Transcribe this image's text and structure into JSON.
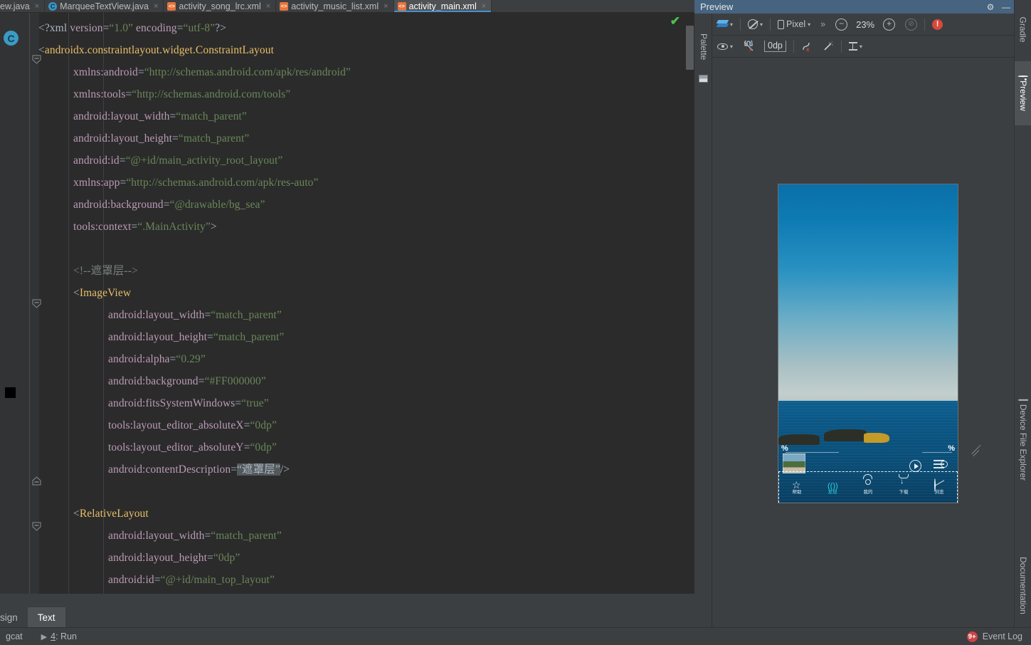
{
  "editor": {
    "tabs": [
      {
        "label": "ew.java",
        "icon": "java-class-icon",
        "type": "java",
        "active": false,
        "clipped": true
      },
      {
        "label": "MarqueeTextView.java",
        "icon": "java-class-icon",
        "type": "java",
        "active": false,
        "clipped": false
      },
      {
        "label": "activity_song_lrc.xml",
        "icon": "xml-layout-icon",
        "type": "xml",
        "active": false,
        "clipped": false
      },
      {
        "label": "activity_music_list.xml",
        "icon": "xml-layout-icon",
        "type": "xml",
        "active": false,
        "clipped": false
      },
      {
        "label": "activity_main.xml",
        "icon": "xml-layout-icon",
        "type": "xml",
        "active": true,
        "clipped": false
      }
    ],
    "tab_close_glyph": "×",
    "gutter": {
      "class_marker": "C",
      "color_swatch": "#000000"
    },
    "inspection_status_icon": "green-check-icon",
    "code_lines": [
      {
        "indent": 0,
        "tokens": [
          {
            "t": "punc",
            "v": "<?xml "
          },
          {
            "t": "attr",
            "v": "version"
          },
          {
            "t": "punc",
            "v": "="
          },
          {
            "t": "str",
            "v": "“1.0”"
          },
          {
            "t": "punc",
            "v": " "
          },
          {
            "t": "attr",
            "v": "encoding"
          },
          {
            "t": "punc",
            "v": "="
          },
          {
            "t": "str",
            "v": "“utf-8”"
          },
          {
            "t": "punc",
            "v": "?>"
          }
        ]
      },
      {
        "indent": 0,
        "tokens": [
          {
            "t": "punc",
            "v": "<"
          },
          {
            "t": "tagname",
            "v": "androidx.constraintlayout.widget.ConstraintLayout"
          }
        ]
      },
      {
        "indent": 1,
        "tokens": [
          {
            "t": "attr",
            "v": "xmlns:android"
          },
          {
            "t": "punc",
            "v": "="
          },
          {
            "t": "str",
            "v": "“http://schemas.android.com/apk/res/android”"
          }
        ]
      },
      {
        "indent": 1,
        "tokens": [
          {
            "t": "attr",
            "v": "xmlns:tools"
          },
          {
            "t": "punc",
            "v": "="
          },
          {
            "t": "str",
            "v": "“http://schemas.android.com/tools”"
          }
        ]
      },
      {
        "indent": 1,
        "tokens": [
          {
            "t": "attr",
            "v": "android:layout_width"
          },
          {
            "t": "punc",
            "v": "="
          },
          {
            "t": "str",
            "v": "“match_parent”"
          }
        ]
      },
      {
        "indent": 1,
        "tokens": [
          {
            "t": "attr",
            "v": "android:layout_height"
          },
          {
            "t": "punc",
            "v": "="
          },
          {
            "t": "str",
            "v": "“match_parent”"
          }
        ]
      },
      {
        "indent": 1,
        "tokens": [
          {
            "t": "attr",
            "v": "android:id"
          },
          {
            "t": "punc",
            "v": "="
          },
          {
            "t": "str",
            "v": "“@+id/main_activity_root_layout”"
          }
        ]
      },
      {
        "indent": 1,
        "tokens": [
          {
            "t": "attr",
            "v": "xmlns:app"
          },
          {
            "t": "punc",
            "v": "="
          },
          {
            "t": "str",
            "v": "“http://schemas.android.com/apk/res-auto”"
          }
        ]
      },
      {
        "indent": 1,
        "tokens": [
          {
            "t": "attr",
            "v": "android:background"
          },
          {
            "t": "punc",
            "v": "="
          },
          {
            "t": "str",
            "v": "“@drawable/bg_sea”"
          }
        ]
      },
      {
        "indent": 1,
        "tokens": [
          {
            "t": "attr",
            "v": "tools:context"
          },
          {
            "t": "punc",
            "v": "="
          },
          {
            "t": "str",
            "v": "“.MainActivity”"
          },
          {
            "t": "punc",
            "v": ">"
          }
        ]
      },
      {
        "indent": 0,
        "tokens": []
      },
      {
        "indent": 1,
        "tokens": [
          {
            "t": "cmt",
            "v": "<!--遮罩层-->"
          }
        ]
      },
      {
        "indent": 1,
        "tokens": [
          {
            "t": "punc",
            "v": "<"
          },
          {
            "t": "tagname",
            "v": "ImageView"
          }
        ]
      },
      {
        "indent": 2,
        "tokens": [
          {
            "t": "attr",
            "v": "android:layout_width"
          },
          {
            "t": "punc",
            "v": "="
          },
          {
            "t": "str",
            "v": "“match_parent”"
          }
        ]
      },
      {
        "indent": 2,
        "tokens": [
          {
            "t": "attr",
            "v": "android:layout_height"
          },
          {
            "t": "punc",
            "v": "="
          },
          {
            "t": "str",
            "v": "“match_parent”"
          }
        ]
      },
      {
        "indent": 2,
        "tokens": [
          {
            "t": "attr",
            "v": "android:alpha"
          },
          {
            "t": "punc",
            "v": "="
          },
          {
            "t": "str",
            "v": "“0.29”"
          }
        ]
      },
      {
        "indent": 2,
        "tokens": [
          {
            "t": "attr",
            "v": "android:background"
          },
          {
            "t": "punc",
            "v": "="
          },
          {
            "t": "str",
            "v": "“#FF000000”"
          }
        ]
      },
      {
        "indent": 2,
        "tokens": [
          {
            "t": "attr",
            "v": "android:fitsSystemWindows"
          },
          {
            "t": "punc",
            "v": "="
          },
          {
            "t": "str",
            "v": "“true”"
          }
        ]
      },
      {
        "indent": 2,
        "tokens": [
          {
            "t": "attr",
            "v": "tools:layout_editor_absoluteX"
          },
          {
            "t": "punc",
            "v": "="
          },
          {
            "t": "str",
            "v": "“0dp”"
          }
        ]
      },
      {
        "indent": 2,
        "tokens": [
          {
            "t": "attr",
            "v": "tools:layout_editor_absoluteY"
          },
          {
            "t": "punc",
            "v": "="
          },
          {
            "t": "str",
            "v": "“0dp”"
          }
        ]
      },
      {
        "indent": 2,
        "tokens": [
          {
            "t": "attr",
            "v": "android:contentDescription"
          },
          {
            "t": "punc",
            "v": "="
          },
          {
            "t": "hl",
            "v": "“遮罩层”"
          },
          {
            "t": "punc",
            "v": "/>"
          }
        ]
      },
      {
        "indent": 0,
        "tokens": []
      },
      {
        "indent": 1,
        "tokens": [
          {
            "t": "punc",
            "v": "<"
          },
          {
            "t": "tagname",
            "v": "RelativeLayout"
          }
        ]
      },
      {
        "indent": 2,
        "tokens": [
          {
            "t": "attr",
            "v": "android:layout_width"
          },
          {
            "t": "punc",
            "v": "="
          },
          {
            "t": "str",
            "v": "“match_parent”"
          }
        ]
      },
      {
        "indent": 2,
        "tokens": [
          {
            "t": "attr",
            "v": "android:layout_height"
          },
          {
            "t": "punc",
            "v": "="
          },
          {
            "t": "str",
            "v": "“0dp”"
          }
        ]
      },
      {
        "indent": 2,
        "tokens": [
          {
            "t": "attr",
            "v": "android:id"
          },
          {
            "t": "punc",
            "v": "="
          },
          {
            "t": "str",
            "v": "“@+id/main_top_layout”"
          }
        ]
      }
    ],
    "mode_tabs": [
      {
        "label": "sign",
        "active": false,
        "clipped": true
      },
      {
        "label": "Text",
        "active": true,
        "clipped": false
      }
    ]
  },
  "preview": {
    "title": "Preview",
    "settings_glyph": "⚙",
    "minimize_glyph": "—",
    "palette_label": "Palette",
    "toolbar_row1": {
      "layers_caret": "▾",
      "orientation_caret": "▾",
      "device_label": "Pixel",
      "device_caret": "▾",
      "overflow": "»",
      "zoom_out": "−",
      "zoom_value": "23%",
      "zoom_in": "+",
      "zoom_fit": "⊘",
      "error_glyph": "!"
    },
    "toolbar_row2": {
      "eye_caret": "▾",
      "margin_value": "0dp",
      "baseline_caret": "▾"
    },
    "device_screen": {
      "percent_mark_left": "%",
      "percent_mark_right": "%",
      "nav_items": [
        {
          "label": "帮助",
          "icon": "star-icon",
          "selected": false
        },
        {
          "label": "发现",
          "icon": "wave-icon",
          "selected": true
        },
        {
          "label": "我的",
          "icon": "user-icon",
          "selected": false
        },
        {
          "label": "下载",
          "icon": "download-icon",
          "selected": false
        },
        {
          "label": "浏览",
          "icon": "browse-icon",
          "selected": false
        }
      ]
    }
  },
  "right_rail": [
    {
      "label": "Gradle",
      "icon": "gradle-icon",
      "selected": false
    },
    {
      "label": "Preview",
      "icon": "preview-eye-icon",
      "selected": true
    },
    {
      "label": "Device File Explorer",
      "icon": "device-file-explorer-icon",
      "selected": false
    },
    {
      "label": "Documentation",
      "icon": "documentation-icon",
      "selected": false
    }
  ],
  "status_bar": {
    "logcat_label": "gcat",
    "run_play_glyph": "▶",
    "run_label_num": "4",
    "run_label_rest": ": Run",
    "event_log_label": "Event Log",
    "event_log_count": "9+"
  }
}
